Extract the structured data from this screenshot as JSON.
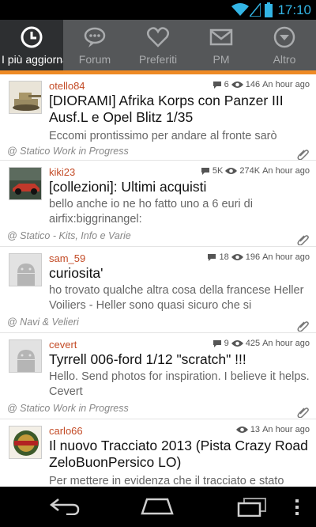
{
  "status": {
    "time": "17:10"
  },
  "tabs": [
    {
      "label": "I più aggiornati",
      "icon": "clock-icon",
      "active": true
    },
    {
      "label": "Forum",
      "icon": "chat-bubble-icon",
      "active": false
    },
    {
      "label": "Preferiti",
      "icon": "heart-icon",
      "active": false
    },
    {
      "label": "PM",
      "icon": "envelope-icon",
      "active": false
    },
    {
      "label": "Altro",
      "icon": "dropdown-circle-icon",
      "active": false
    }
  ],
  "topics": [
    {
      "author": "otello84",
      "replies": "6",
      "views": "146",
      "time": "An hour ago",
      "title": "[DIORAMI] Afrika Korps con Panzer III Ausf.L e Opel Blitz 1/35",
      "preview": "Eccomi prontissimo per andare al fronte sarò",
      "forum": "@ Statico Work in Progress",
      "thumb": "tank-thumbnail"
    },
    {
      "author": "kiki23",
      "replies": "5K",
      "views": "274K",
      "time": "An hour ago",
      "title": "[collezioni]: Ultimi acquisti",
      "preview": "bello anche io ne ho fatto uno a 6 euri di airfix:biggrinangel:",
      "forum": "@ Statico - Kits, Info e Varie",
      "thumb": "car-thumbnail"
    },
    {
      "author": "sam_59",
      "replies": "18",
      "views": "196",
      "time": "An hour ago",
      "title": "curiosita'",
      "preview": "ho trovato qualche altra cosa della francese Heller Voiliers - Heller sono quasi sicuro che si",
      "forum": "@ Navi & Velieri",
      "thumb": "android-avatar"
    },
    {
      "author": "cevert",
      "replies": "9",
      "views": "425",
      "time": "An hour ago",
      "title": "Tyrrell 006-ford 1/12 \"scratch\" !!!",
      "preview": "Hello. Send photos for inspiration. I believe it helps. Cevert",
      "forum": "@ Statico Work in Progress",
      "thumb": "android-avatar"
    },
    {
      "author": "carlo66",
      "replies": "",
      "views": "13",
      "time": "An hour ago",
      "title": "Il nuovo Tracciato 2013 (Pista Crazy Road ZeloBuonPersico LO)",
      "preview": "Per mettere in evidenza che il tracciato e stato",
      "forum": "",
      "thumb": "logo-thumbnail"
    }
  ]
}
